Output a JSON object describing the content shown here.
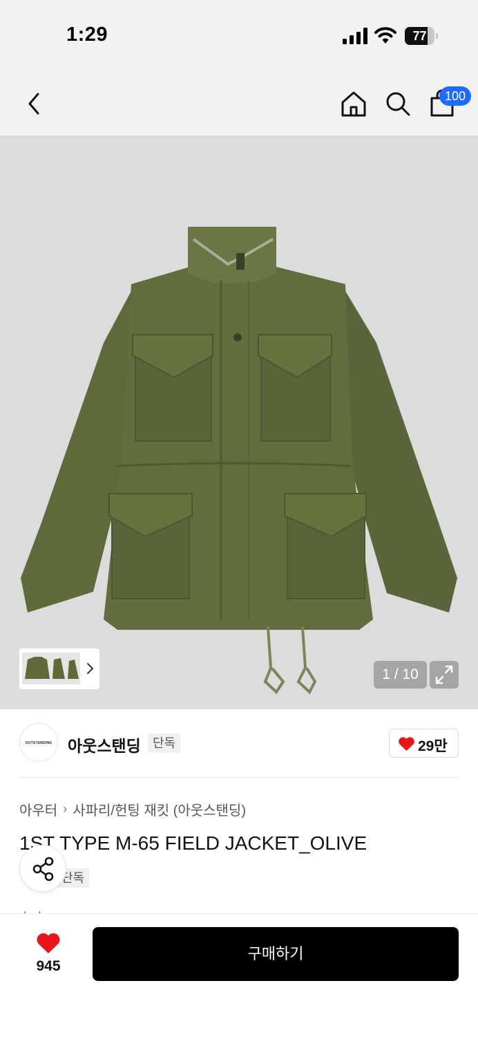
{
  "status_bar": {
    "time": "1:29",
    "battery_level": "77",
    "battery_fraction": 0.77
  },
  "nav": {
    "icons": [
      "back-icon",
      "home-icon",
      "search-icon",
      "shopping-bag-icon"
    ],
    "cart_badge": "100"
  },
  "gallery": {
    "counter": "1 / 10",
    "icons": [
      "chevron-right-icon",
      "expand-icon"
    ],
    "background_color": "#dcdcdc",
    "jacket_color": "#5e6a3a"
  },
  "brand": {
    "logo_text": "OUTSTANDING",
    "name": "아웃스탠딩",
    "tag": "단독",
    "likes": "29만"
  },
  "breadcrumb": {
    "level1": "아우터",
    "separator": "›",
    "level2": "사파리/헌팅 재킷 (아웃스탠딩)"
  },
  "product": {
    "title": "1ST TYPE M-65 FIELD JACKET_OLIVE",
    "tag": "단독"
  },
  "bottom_bar": {
    "wish_count": "945",
    "buy_label": "구매하기"
  },
  "colors": {
    "accent_badge": "#1f6bff",
    "heart": "#e8151b",
    "buy_button": "#000000"
  }
}
